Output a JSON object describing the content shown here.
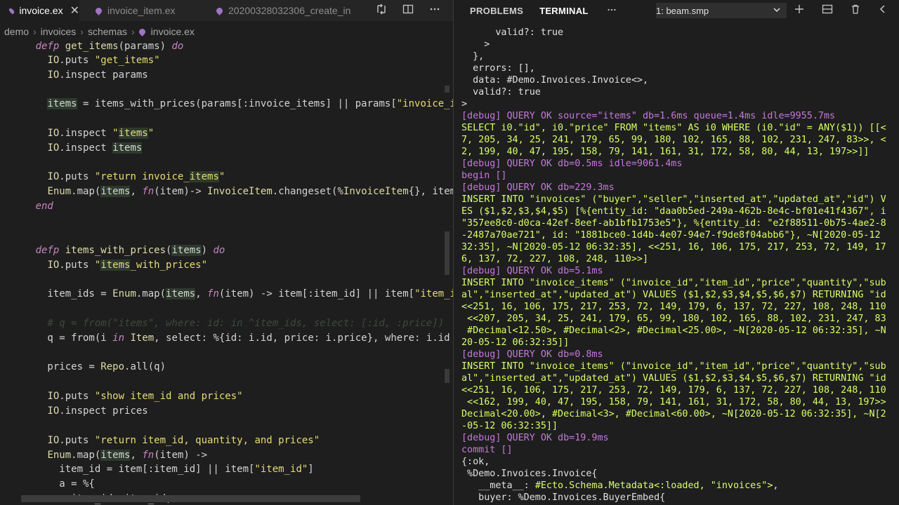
{
  "editor": {
    "tabs": [
      {
        "label": "invoice.ex",
        "active": true,
        "close": "✕"
      },
      {
        "label": "invoice_item.ex",
        "active": false
      },
      {
        "label": "20200328032306_create_in",
        "active": false
      }
    ],
    "breadcrumb": [
      "demo",
      "invoices",
      "schemas",
      "invoice.ex"
    ]
  },
  "terminal": {
    "tabs": [
      "PROBLEMS",
      "TERMINAL"
    ],
    "active_tab": "TERMINAL",
    "selected_terminal": "1: beam.smp"
  },
  "colors": {
    "background": "#1e1e1e",
    "keyword": "#c586c0",
    "function": "#dcdcaa",
    "string": "#e6db74",
    "debug": "#c678dd",
    "sql": "#d7ff66"
  }
}
